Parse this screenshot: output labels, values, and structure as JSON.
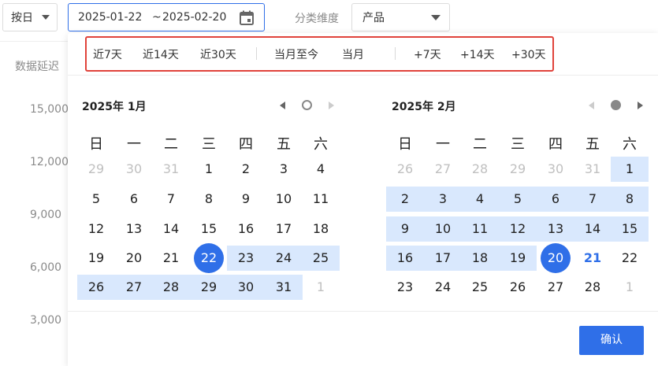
{
  "toolbar": {
    "granularity": "按日",
    "date_start": "2025-01-22",
    "date_sep": "~",
    "date_end": "2025-02-20",
    "category_label": "分类维度",
    "category_value": "产品"
  },
  "background": {
    "latency_label": "数据延迟",
    "y_ticks": [
      "15,000",
      "12,000",
      "9,000",
      "6,000",
      "3,000"
    ]
  },
  "quick_ranges": {
    "last7": "近7天",
    "last14": "近14天",
    "last30": "近30天",
    "month_to_date": "当月至今",
    "this_month": "当月",
    "plus7": "+7天",
    "plus14": "+14天",
    "plus30": "+30天"
  },
  "calendar_left": {
    "title": "2025年 1月",
    "weekdays": [
      "日",
      "一",
      "二",
      "三",
      "四",
      "五",
      "六"
    ],
    "weeks": [
      [
        "29",
        "30",
        "31",
        "1",
        "2",
        "3",
        "4"
      ],
      [
        "5",
        "6",
        "7",
        "8",
        "9",
        "10",
        "11"
      ],
      [
        "12",
        "13",
        "14",
        "15",
        "16",
        "17",
        "18"
      ],
      [
        "19",
        "20",
        "21",
        "22",
        "23",
        "24",
        "25"
      ],
      [
        "26",
        "27",
        "28",
        "29",
        "30",
        "31",
        "1"
      ]
    ]
  },
  "calendar_right": {
    "title": "2025年 2月",
    "weekdays": [
      "日",
      "一",
      "二",
      "三",
      "四",
      "五",
      "六"
    ],
    "weeks": [
      [
        "26",
        "27",
        "28",
        "29",
        "30",
        "31",
        "1"
      ],
      [
        "2",
        "3",
        "4",
        "5",
        "6",
        "7",
        "8"
      ],
      [
        "9",
        "10",
        "11",
        "12",
        "13",
        "14",
        "15"
      ],
      [
        "16",
        "17",
        "18",
        "19",
        "20",
        "21",
        "22"
      ],
      [
        "23",
        "24",
        "25",
        "26",
        "27",
        "28",
        "1"
      ]
    ]
  },
  "confirm_label": "确认",
  "colors": {
    "accent": "#2f6fe8",
    "range": "#d9e8fd",
    "highlight_border": "#e0433b"
  }
}
